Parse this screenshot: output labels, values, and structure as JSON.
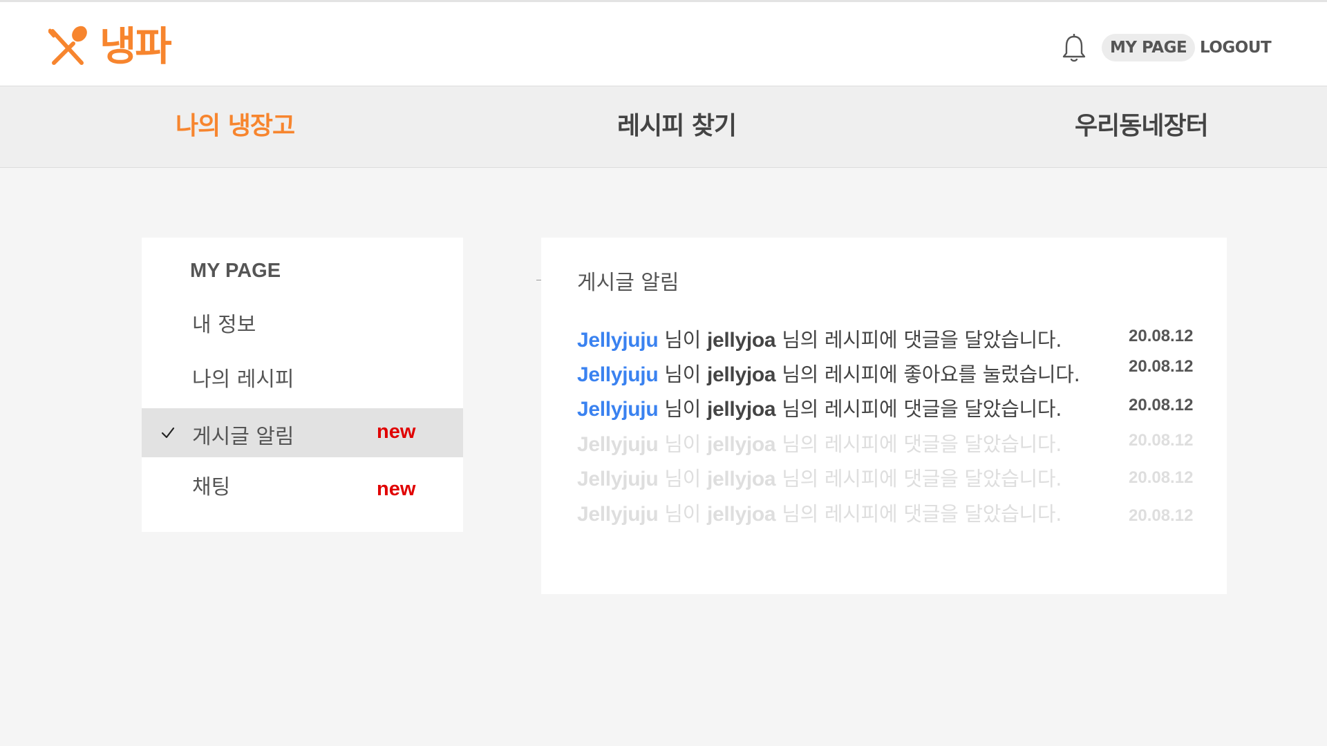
{
  "header": {
    "logo_text": "냉파",
    "mypage_label": "MY PAGE",
    "logout_label": "LOGOUT"
  },
  "nav": {
    "items": [
      {
        "label": "나의 냉장고"
      },
      {
        "label": "레시피 찾기"
      },
      {
        "label": "우리동네장터"
      }
    ],
    "active_index": 0
  },
  "sidebar": {
    "title": "MY PAGE",
    "items": [
      {
        "label": "내 정보"
      },
      {
        "label": "나의 레시피"
      },
      {
        "label": "게시글 알림",
        "badge": "new"
      },
      {
        "label": "채팅",
        "badge": "new"
      }
    ],
    "selected_index": 2
  },
  "panel": {
    "title": "게시글 알림",
    "notifications": [
      {
        "user": "Jellyjuju",
        "mid": " 님이 ",
        "target": "jellyjoa",
        "rest": " 님의 레시피에 댓글을 달았습니다.",
        "date": "20.08.12"
      },
      {
        "user": "Jellyjuju",
        "mid": " 님이 ",
        "target": "jellyjoa",
        "rest": " 님의 레시피에 좋아요를 눌렀습니다.",
        "date": "20.08.12"
      },
      {
        "user": "Jellyjuju",
        "mid": " 님이 ",
        "target": "jellyjoa",
        "rest": " 님의 레시피에 댓글을 달았습니다.",
        "date": "20.08.12"
      },
      {
        "user": "Jellyjuju",
        "mid": " 님이 ",
        "target": "jellyjoa",
        "rest": " 님의 레시피에 댓글을 달았습니다.",
        "date": "20.08.12"
      },
      {
        "user": "Jellyjuju",
        "mid": " 님이 ",
        "target": "jellyjoa",
        "rest": " 님의 레시피에 댓글을 달았습니다.",
        "date": "20.08.12"
      },
      {
        "user": "Jellyjuju",
        "mid": " 님이 ",
        "target": "jellyjoa",
        "rest": " 님의 레시피에 댓글을 달았습니다.",
        "date": "20.08.12"
      }
    ]
  },
  "colors": {
    "brand": "#f7852e",
    "link": "#3a82f0",
    "badge": "#e00000",
    "faded_text": "#dedede"
  },
  "icons": [
    "fork-spoon-icon",
    "bell-icon",
    "check-icon"
  ]
}
